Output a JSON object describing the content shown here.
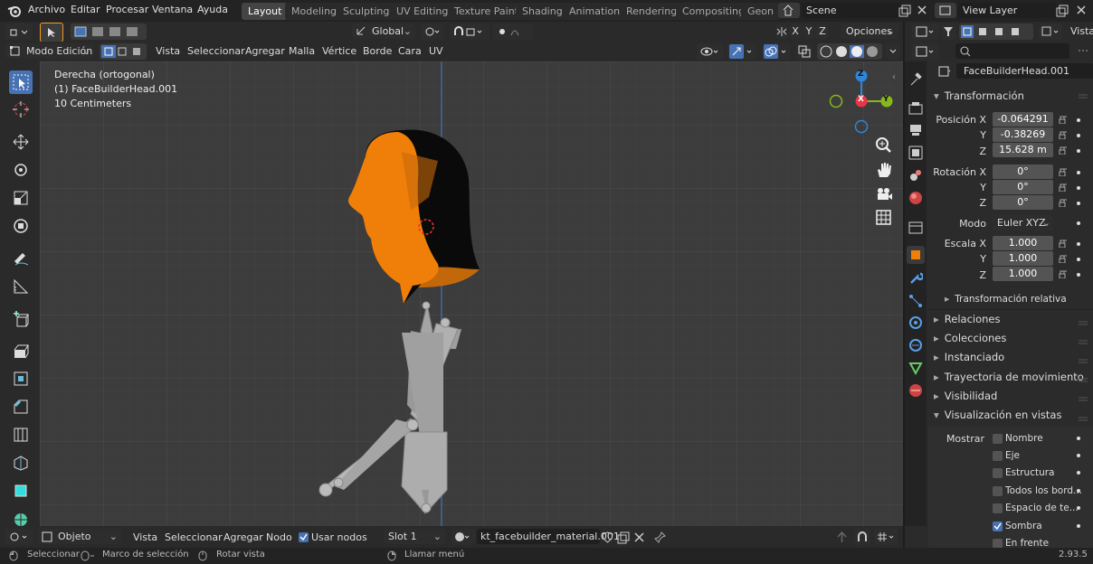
{
  "topbar": {
    "menus": [
      "Archivo",
      "Editar",
      "Procesar",
      "Ventana",
      "Ayuda"
    ],
    "workspaces": [
      "Layout",
      "Modeling",
      "Sculpting",
      "UV Editing",
      "Texture Paint",
      "Shading",
      "Animation",
      "Rendering",
      "Compositing",
      "Geon"
    ],
    "active_workspace": "Layout",
    "scene": "Scene",
    "view_layer": "View Layer"
  },
  "header": {
    "transform_orientation": "Global",
    "axes": [
      "X",
      "Y",
      "Z"
    ],
    "options": "Opciones",
    "mode": "Modo Edición",
    "menus": [
      "Vista",
      "Seleccionar",
      "Agregar",
      "Malla",
      "Vértice",
      "Borde",
      "Cara",
      "UV"
    ]
  },
  "viewport": {
    "view_name": "Derecha (ortogonal)",
    "object_label": "(1) FaceBuilderHead.001",
    "scale_label": "10 Centimeters"
  },
  "gizmo": {
    "x": "X",
    "y": "Y",
    "z": "Z"
  },
  "properties": {
    "vista": "Vista",
    "object_name": "FaceBuilderHead.001",
    "transform": {
      "title": "Transformación",
      "pos_label": "Posición X",
      "y_label": "Y",
      "z_label": "Z",
      "pos_x": "-0.064291",
      "pos_y": "-0.38269",
      "pos_z": "15.628 m",
      "rot_label": "Rotación X",
      "rot_x": "0°",
      "rot_y": "0°",
      "rot_z": "0°",
      "mode_label": "Modo",
      "mode": "Euler XYZ",
      "scale_label": "Escala X",
      "scale_x": "1.000",
      "scale_y": "1.000",
      "scale_z": "1.000",
      "relative": "Transformación relativa"
    },
    "sections": [
      "Relaciones",
      "Colecciones",
      "Instanciado",
      "Trayectoria de movimiento",
      "Visibilidad"
    ],
    "viewport_display": {
      "title": "Visualización en vistas",
      "show_label": "Mostrar",
      "items": [
        {
          "label": "Nombre",
          "checked": false
        },
        {
          "label": "Eje",
          "checked": false
        },
        {
          "label": "Estructura",
          "checked": false
        },
        {
          "label": "Todos los bord...",
          "checked": false
        },
        {
          "label": "Espacio de te...",
          "checked": false
        },
        {
          "label": "Sombra",
          "checked": true
        },
        {
          "label": "En frente",
          "checked": false
        }
      ]
    }
  },
  "footer": {
    "mode": "Objeto",
    "menus": [
      "Vista",
      "Seleccionar",
      "Agregar",
      "Nodo"
    ],
    "use_nodes": "Usar nodos",
    "slot": "Slot 1",
    "material": "kt_facebuilder_material.001"
  },
  "status": {
    "select": "Seleccionar",
    "box_select": "Marco de selección",
    "rotate": "Rotar vista",
    "call_menu": "Llamar menú",
    "version": "2.93.5"
  },
  "colors": {
    "accent": "#4772b3",
    "head_orange": "#f07f0a",
    "x_axis": "#e8354a",
    "y_axis": "#86b81e",
    "z_axis": "#2f86d8"
  }
}
